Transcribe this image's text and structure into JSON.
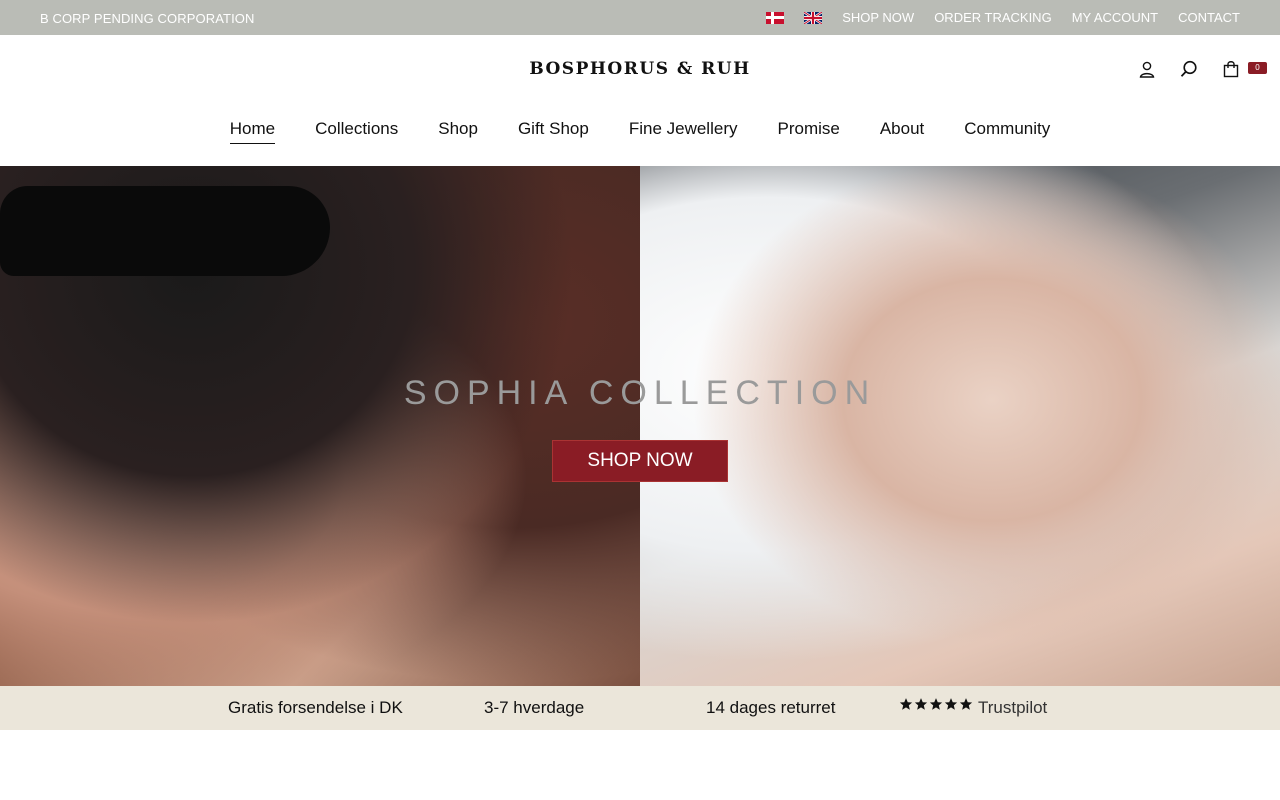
{
  "topbar": {
    "tagline": "B CORP PENDING CORPORATION",
    "links": [
      "SHOP NOW",
      "ORDER TRACKING",
      "MY ACCOUNT",
      "CONTACT"
    ]
  },
  "header": {
    "logo": "BOSPHORUS & RUH",
    "cart_count": "0"
  },
  "nav": {
    "items": [
      "Home",
      "Collections",
      "Shop",
      "Gift Shop",
      "Fine Jewellery",
      "Promise",
      "About",
      "Community"
    ]
  },
  "hero": {
    "title": "SOPHIA COLLECTION",
    "button": "SHOP NOW"
  },
  "usp": {
    "shipping": "Gratis forsendelse i DK",
    "delivery": "3-7 hverdage",
    "returns": "14 dages returret",
    "rating_stars": 5,
    "trustpilot": "Trustpilot"
  },
  "colors": {
    "topbar_bg": "#babcb6",
    "accent": "#8a1c25",
    "usp_bg": "#ebe6da"
  }
}
